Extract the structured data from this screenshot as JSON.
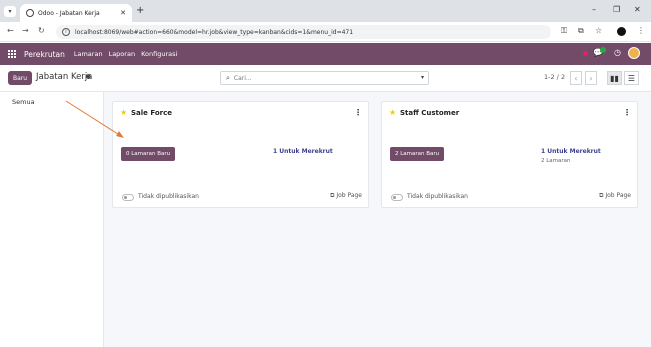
{
  "browser": {
    "tab_title": "Odoo - Jabatan Kerja",
    "url": "localhost:8069/web#action=660&model=hr.job&view_type=kanban&cids=1&menu_id=471"
  },
  "navbar": {
    "brand": "Perekrutan",
    "menus": [
      "Lamaran",
      "Laporan",
      "Konfigurasi"
    ]
  },
  "control_panel": {
    "new_label": "Baru",
    "title": "Jabatan Kerja",
    "search_placeholder": "Cari...",
    "pager": "1-2 / 2"
  },
  "sidebar": {
    "items": [
      {
        "label": "Semua"
      }
    ]
  },
  "cards": [
    {
      "name": "Sale Force",
      "applications_label": "0 Lamaran Baru",
      "to_recruit": "1 Untuk Merekrut",
      "applications_count": "",
      "publish_status": "Tidak dipublikasikan",
      "job_page": "Job Page"
    },
    {
      "name": "Staff Customer",
      "applications_label": "2 Lamaran Baru",
      "to_recruit": "1 Untuk Merekrut",
      "applications_count": "2 Lamaran",
      "publish_status": "Tidak dipublikasikan",
      "job_page": "Job Page"
    }
  ],
  "colors": {
    "brand": "#714b67",
    "annotation_arrow": "#e07b39",
    "favorite_star": "#f3cc00"
  }
}
